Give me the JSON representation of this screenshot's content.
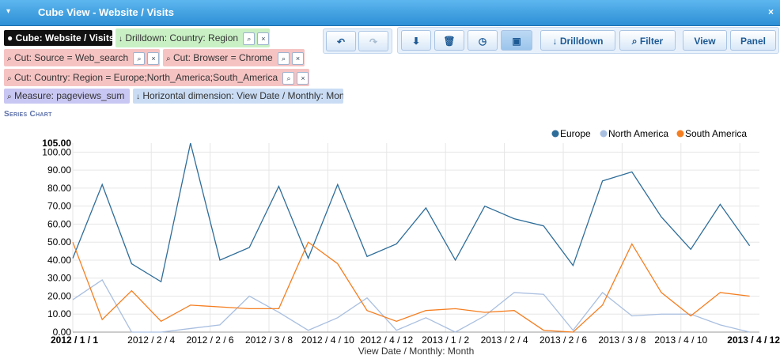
{
  "window": {
    "title": "Cube View - Website / Visits",
    "collapse_glyph": "▾",
    "close_glyph": "×"
  },
  "filters": {
    "cube": "Cube: Website / Visits",
    "drilldown": "Drilldown: Country: Region",
    "cut_source": "Cut: Source = Web_search",
    "cut_browser": "Cut: Browser = Chrome",
    "cut_country": "Cut: Country: Region = Europe;North_America;South_America",
    "measure": "Measure: pageviews_sum",
    "horizontal": "Horizontal dimension: View Date / Monthly: Month"
  },
  "toolbar": {
    "undo_glyph": "↶",
    "redo_glyph": "↷",
    "drilldown_label": "Drilldown",
    "filter_label": "Filter",
    "view_label": "View",
    "panel_label": "Panel"
  },
  "section": {
    "title": "Series Chart"
  },
  "colors": {
    "europe": "#2e6d99",
    "north_america": "#a9bfe0",
    "south_america": "#f57e20",
    "titlebar": "#2d8fd6"
  },
  "chart_data": {
    "type": "line",
    "xlabel": "View Date / Monthly: Month",
    "ylim": [
      0,
      105
    ],
    "y_ticks": [
      "0.00",
      "10.00",
      "20.00",
      "30.00",
      "40.00",
      "50.00",
      "60.00",
      "70.00",
      "80.00",
      "90.00",
      "100.00",
      "105.00"
    ],
    "x_ticks": [
      {
        "i": 0,
        "label": "2012 / 1 / 1",
        "bold": true
      },
      {
        "i": 4,
        "label": "2012 / 2 / 4",
        "bold": false
      },
      {
        "i": 7,
        "label": "2012 / 2 / 6",
        "bold": false
      },
      {
        "i": 10,
        "label": "2012 / 3 / 8",
        "bold": false
      },
      {
        "i": 13,
        "label": "2012 / 4 / 10",
        "bold": false
      },
      {
        "i": 16,
        "label": "2012 / 4 / 12",
        "bold": false
      },
      {
        "i": 19,
        "label": "2013 / 1 / 2",
        "bold": false
      },
      {
        "i": 22,
        "label": "2013 / 2 / 4",
        "bold": false
      },
      {
        "i": 25,
        "label": "2013 / 2 / 6",
        "bold": false
      },
      {
        "i": 28,
        "label": "2013 / 3 / 8",
        "bold": false
      },
      {
        "i": 31,
        "label": "2013 / 4 / 10",
        "bold": false
      },
      {
        "i": 34,
        "label": "2013 / 4 / 12",
        "bold": true
      }
    ],
    "legend_position": "top-right",
    "series": [
      {
        "name": "Europe",
        "color": "#2e6d99",
        "values": [
          41,
          82,
          38,
          28,
          105,
          40,
          47,
          81,
          41,
          82,
          42,
          49,
          69,
          40,
          70,
          63,
          59,
          37,
          84,
          89,
          64,
          46,
          71,
          48
        ]
      },
      {
        "name": "North America",
        "color": "#a9bfe0",
        "values": [
          18,
          29,
          0,
          0,
          2,
          4,
          20,
          11,
          1,
          8,
          19,
          1,
          8,
          0,
          9,
          22,
          21,
          1,
          22,
          9,
          10,
          10,
          4,
          0
        ]
      },
      {
        "name": "South America",
        "color": "#f57e20",
        "values": [
          50,
          7,
          23,
          6,
          15,
          14,
          13,
          13,
          50,
          38,
          12,
          6,
          12,
          13,
          11,
          12,
          1,
          0,
          15,
          49,
          22,
          9,
          22,
          20
        ]
      }
    ]
  }
}
